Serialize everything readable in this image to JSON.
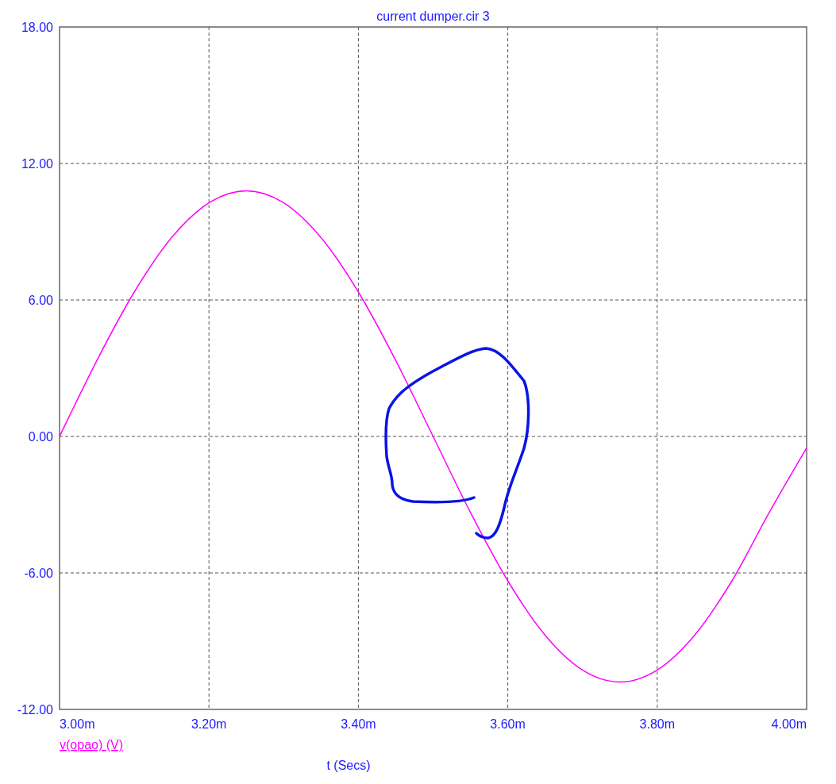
{
  "chart": {
    "chart_data": {
      "type": "line",
      "title": "current dumper.cir 3",
      "xlabel": "t (Secs)",
      "x": [
        3.0,
        3.05,
        3.1,
        3.15,
        3.2,
        3.25,
        3.3,
        3.35,
        3.4,
        3.45,
        3.5,
        3.55,
        3.6,
        3.65,
        3.7,
        3.75,
        3.8,
        3.85,
        3.9,
        3.95,
        4.0
      ],
      "series": [
        {
          "name": "v(opao) (V)",
          "color": "#ff00ff",
          "values": [
            0,
            3.34,
            6.35,
            8.74,
            10.27,
            10.8,
            10.27,
            8.74,
            6.35,
            3.34,
            0,
            -3.34,
            -6.35,
            -8.74,
            -10.27,
            -10.8,
            -10.27,
            -8.74,
            -6.35,
            -3.34,
            -0.5
          ]
        }
      ],
      "xlim": [
        3.0,
        4.0
      ],
      "grid": true,
      "ylim": [
        -12,
        18
      ],
      "xticks": [
        {
          "value": 3.0,
          "label": "3.00m"
        },
        {
          "value": 3.2,
          "label": "3.20m"
        },
        {
          "value": 3.4,
          "label": "3.40m"
        },
        {
          "value": 3.6,
          "label": "3.60m"
        },
        {
          "value": 3.8,
          "label": "3.80m"
        },
        {
          "value": 4.0,
          "label": "4.00m"
        }
      ],
      "yticks": [
        {
          "value": -12,
          "label": "-12.00"
        },
        {
          "value": -6,
          "label": "-6.00"
        },
        {
          "value": 0,
          "label": "0.00"
        },
        {
          "value": 6,
          "label": "6.00"
        },
        {
          "value": 12,
          "label": "12.00"
        },
        {
          "value": 18,
          "label": "18.00"
        }
      ]
    }
  }
}
